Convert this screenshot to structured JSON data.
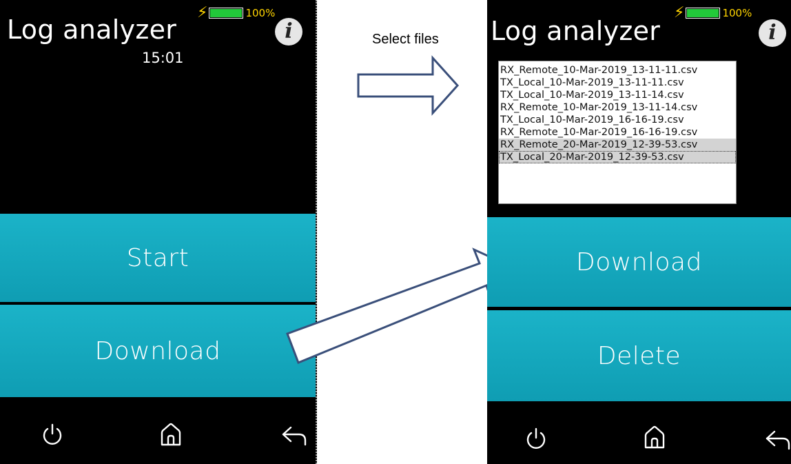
{
  "caption": "Select files",
  "left_screen": {
    "title": "Log analyzer",
    "battery_percent": "100%",
    "battery_level": 1.0,
    "time": "15:01",
    "buttons": {
      "start": "Start",
      "download": "Download"
    },
    "nav": {
      "power": "⏻",
      "home": "⌂",
      "back": "↩"
    }
  },
  "right_screen": {
    "title": "Log analyzer",
    "battery_percent": "100%",
    "battery_level": 1.0,
    "files": [
      "RX_Remote_10-Mar-2019_13-11-11.csv",
      "TX_Local_10-Mar-2019_13-11-11.csv",
      "TX_Local_10-Mar-2019_13-11-14.csv",
      "RX_Remote_10-Mar-2019_13-11-14.csv",
      "TX_Local_10-Mar-2019_16-16-19.csv",
      "RX_Remote_10-Mar-2019_16-16-19.csv",
      "RX_Remote_20-Mar-2019_12-39-53.csv",
      "TX_Local_20-Mar-2019_12-39-53.csv"
    ],
    "selected_files": [
      6,
      7
    ],
    "buttons": {
      "download": "Download",
      "delete": "Delete"
    },
    "nav": {
      "power": "⏻",
      "home": "⌂",
      "back": "↩"
    }
  },
  "colors": {
    "button": "#13a8bd",
    "battery_fill": "#22c93a",
    "bolt": "#ffd400",
    "arrow_stroke": "#3a4f7a"
  },
  "icons": [
    "lightning-icon",
    "battery-icon",
    "info-icon",
    "power-icon",
    "home-icon",
    "back-icon",
    "arrow-icon"
  ]
}
